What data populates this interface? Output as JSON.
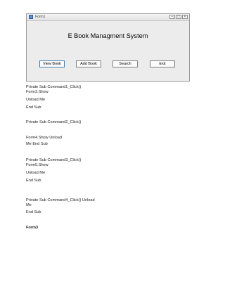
{
  "window": {
    "title": "Form1",
    "controls": {
      "minimize": "–",
      "maximize": "□",
      "close": "×"
    }
  },
  "form": {
    "heading": "E Book Managment System",
    "buttons": [
      "View Book",
      "Add Book",
      "Search",
      "Exit"
    ]
  },
  "code_lines": [
    "Private Sub Command1_Click()",
    "Form3.Show",
    "Unload Me",
    "End Sub",
    "Private Sub Command2_Click()",
    "Form4.Show Unload",
    "Me End Sub",
    "Private Sub Command3_Click()",
    "Form5.Show",
    "Unload Me",
    "End Sub",
    "Private Sub Command4_Click() Unload",
    "Me",
    "End Sub",
    "Form3"
  ]
}
